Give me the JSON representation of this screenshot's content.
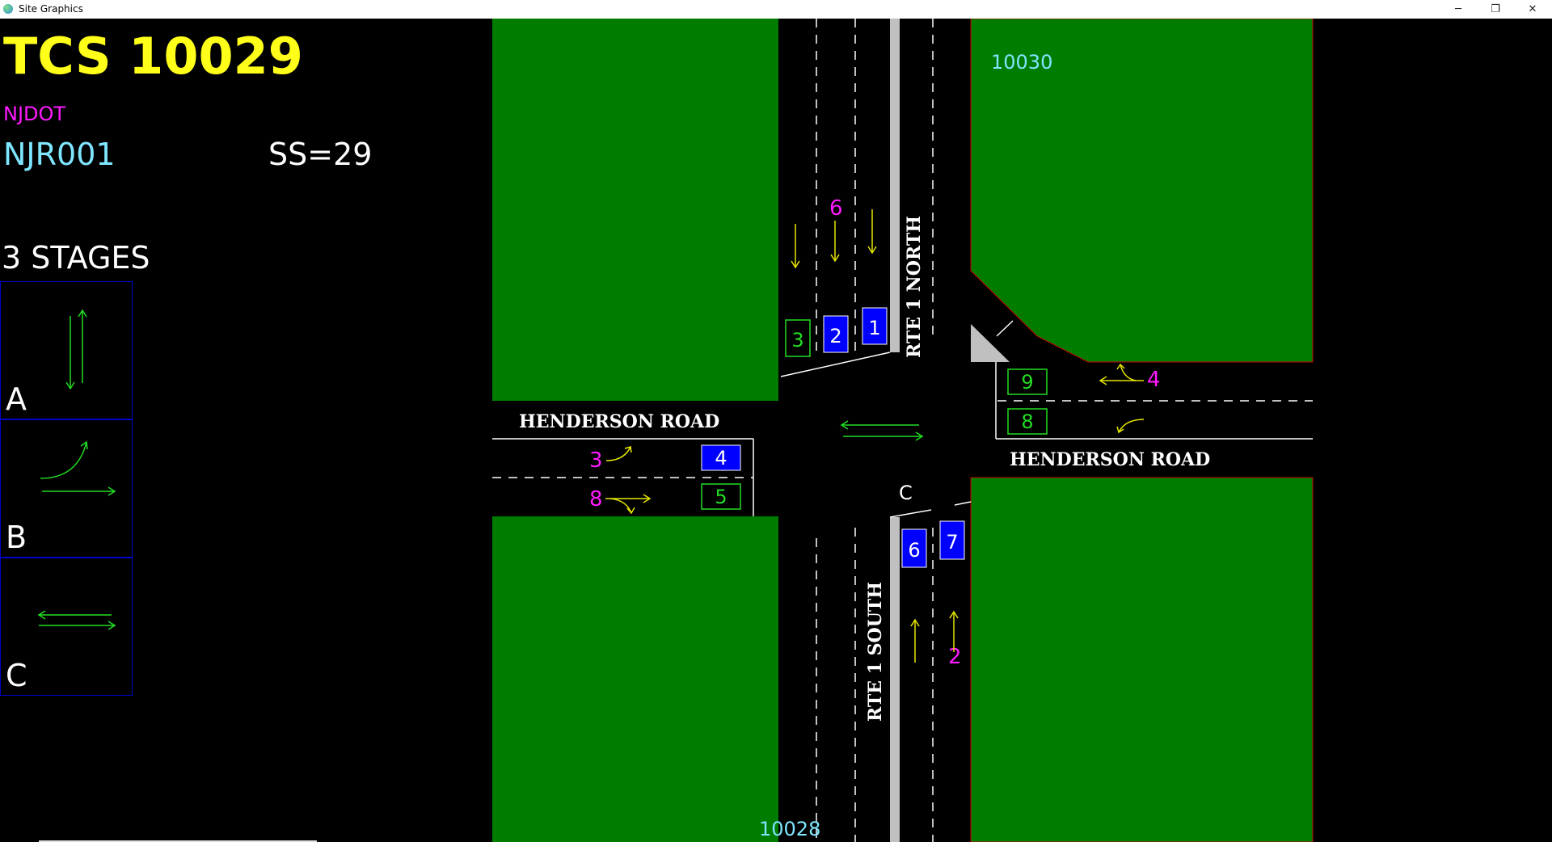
{
  "window": {
    "title": "Site Graphics",
    "minimize_glyph": "─",
    "restore_glyph": "❐",
    "close_glyph": "✕"
  },
  "header": {
    "tcs": "TCS 10029",
    "agency": "NJDOT",
    "region": "NJR001",
    "ss": "SS=29",
    "stages_label": "3 STAGES"
  },
  "stages": [
    {
      "label": "A"
    },
    {
      "label": "B"
    },
    {
      "label": "C"
    }
  ],
  "map": {
    "roads": {
      "north": "RTE 1 NORTH",
      "south": "RTE 1 SOUTH",
      "west": "HENDERSON ROAD",
      "east": "HENDERSON ROAD"
    },
    "site_refs": {
      "ne": "10030",
      "south": "10028"
    },
    "detectors": {
      "d1": "1",
      "d2": "2",
      "d3": "3",
      "d4": "4",
      "d5": "5",
      "d6": "6",
      "d7": "7",
      "d8": "8",
      "d9": "9"
    },
    "phases": {
      "p6": "6",
      "p4": "4",
      "p3": "3",
      "p8": "8",
      "p2": "2"
    },
    "stage_c_marker": "C"
  },
  "colors": {
    "grass": "#007d00",
    "road": "#000000",
    "arrow_yellow": "#e6e600",
    "stage_green": "#22dd22",
    "detector_blue": "#0000ff",
    "phase_magenta": "#ff1aff",
    "title_yellow": "#ffff1a",
    "cyan_text": "#7fe6ff"
  }
}
